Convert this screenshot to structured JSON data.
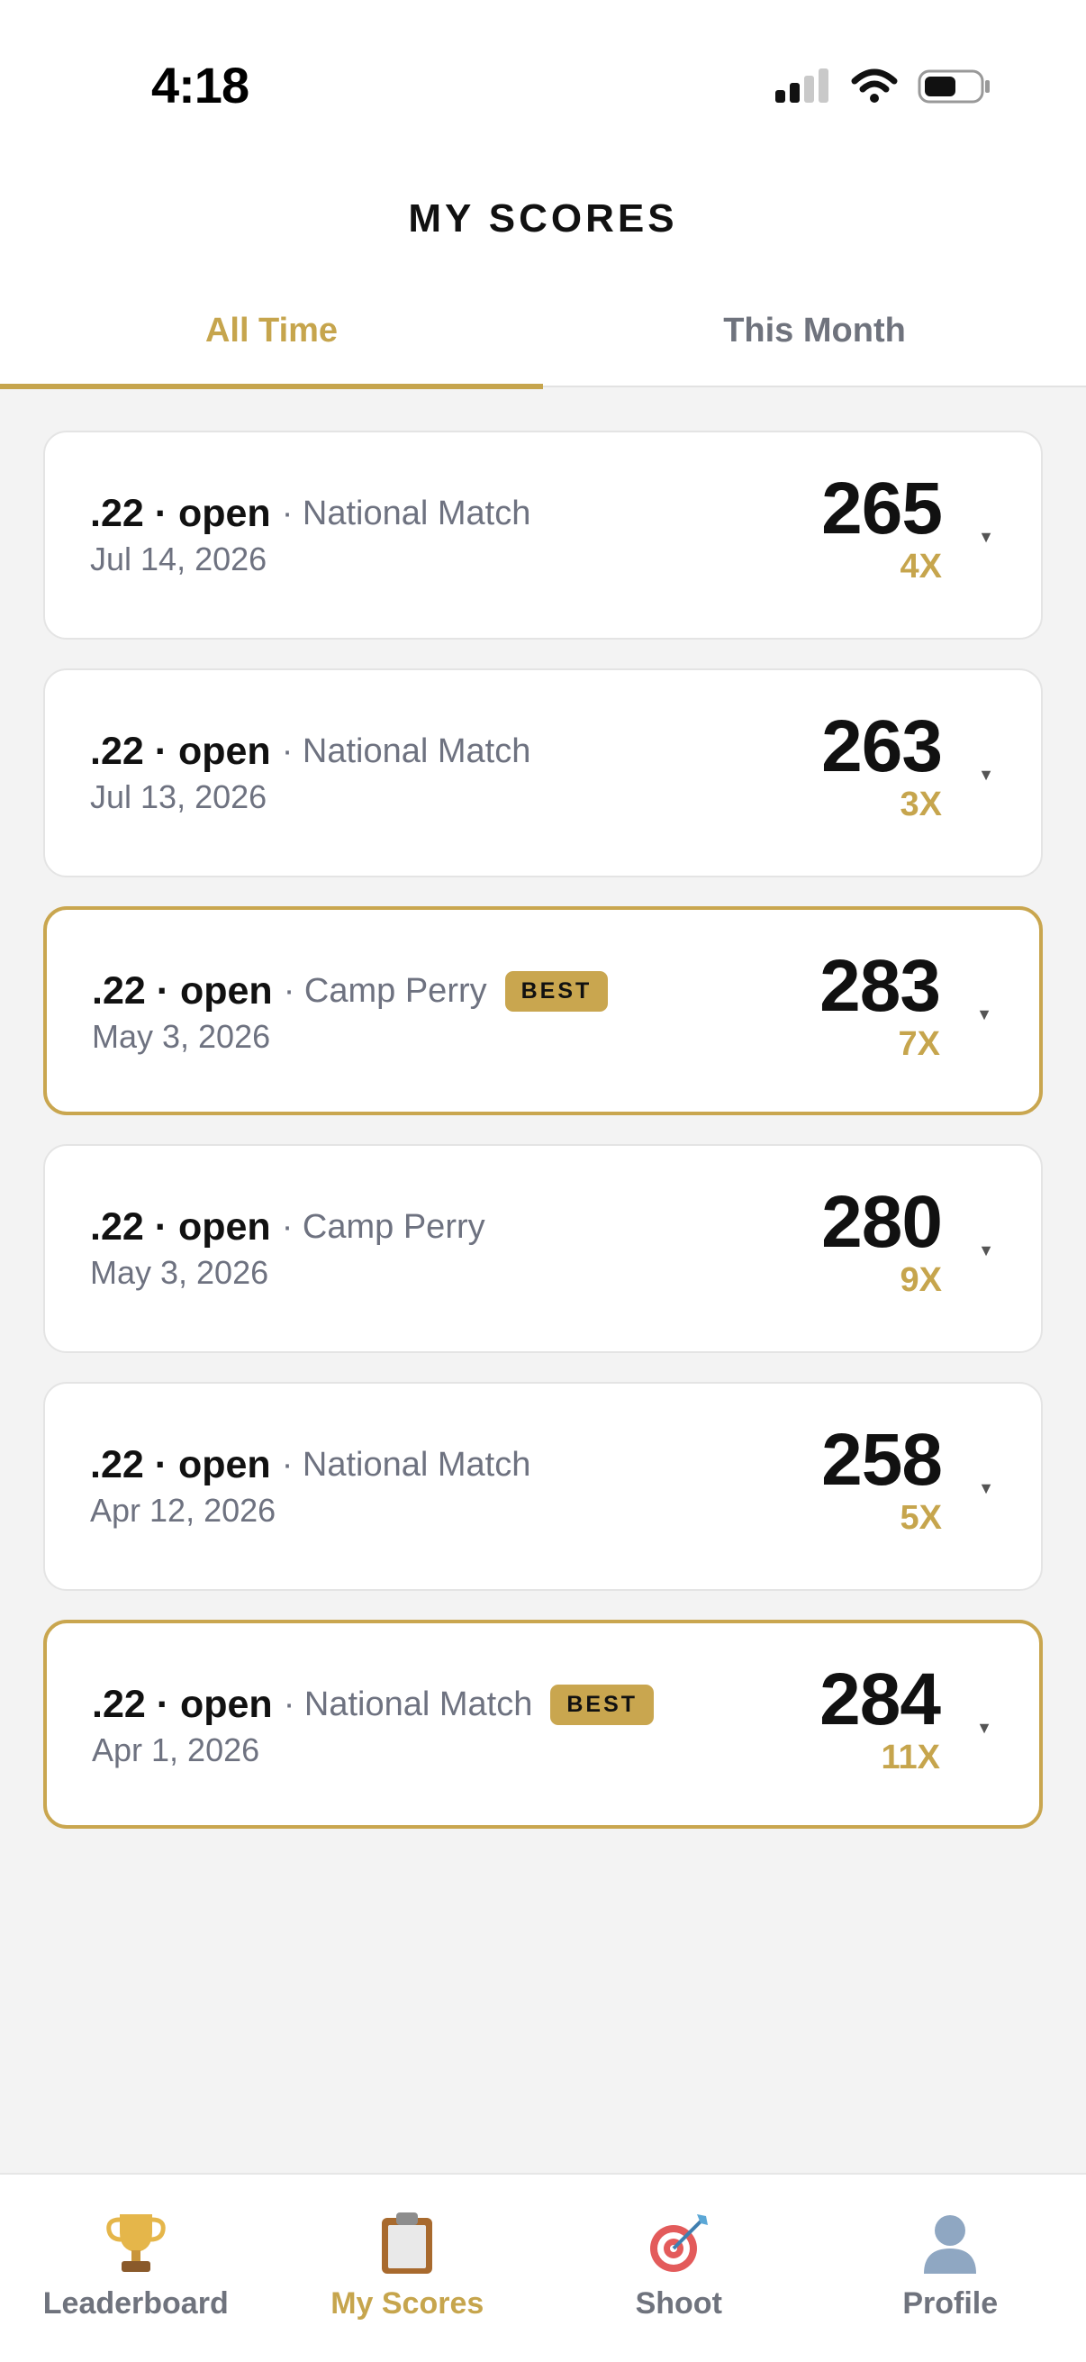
{
  "status_bar": {
    "time": "4:18"
  },
  "header": {
    "title": "MY SCORES",
    "tabs": [
      {
        "label": "All Time",
        "active": true
      },
      {
        "label": "This Month",
        "active": false
      }
    ]
  },
  "scores": [
    {
      "caliber": ".22 · open",
      "match": "· National Match",
      "date": "Jul 14, 2026",
      "score": "265",
      "x": "4X",
      "best": false,
      "best_label": ""
    },
    {
      "caliber": ".22 · open",
      "match": "· National Match",
      "date": "Jul 13, 2026",
      "score": "263",
      "x": "3X",
      "best": false,
      "best_label": ""
    },
    {
      "caliber": ".22 · open",
      "match": "· Camp Perry",
      "date": "May 3, 2026",
      "score": "283",
      "x": "7X",
      "best": true,
      "best_label": "BEST"
    },
    {
      "caliber": ".22 · open",
      "match": "· Camp Perry",
      "date": "May 3, 2026",
      "score": "280",
      "x": "9X",
      "best": false,
      "best_label": ""
    },
    {
      "caliber": ".22 · open",
      "match": "· National Match",
      "date": "Apr 12, 2026",
      "score": "258",
      "x": "5X",
      "best": false,
      "best_label": ""
    },
    {
      "caliber": ".22 · open",
      "match": "· National Match",
      "date": "Apr 1, 2026",
      "score": "284",
      "x": "11X",
      "best": true,
      "best_label": "BEST"
    }
  ],
  "bottom_nav": [
    {
      "label": "Leaderboard",
      "icon": "trophy-icon",
      "active": false
    },
    {
      "label": "My Scores",
      "icon": "clipboard-icon",
      "active": true
    },
    {
      "label": "Shoot",
      "icon": "target-icon",
      "active": false
    },
    {
      "label": "Profile",
      "icon": "profile-icon",
      "active": false
    }
  ],
  "colors": {
    "accent": "#c6a54d",
    "text": "#111111",
    "muted": "#6e7280",
    "background": "#f3f3f3"
  }
}
